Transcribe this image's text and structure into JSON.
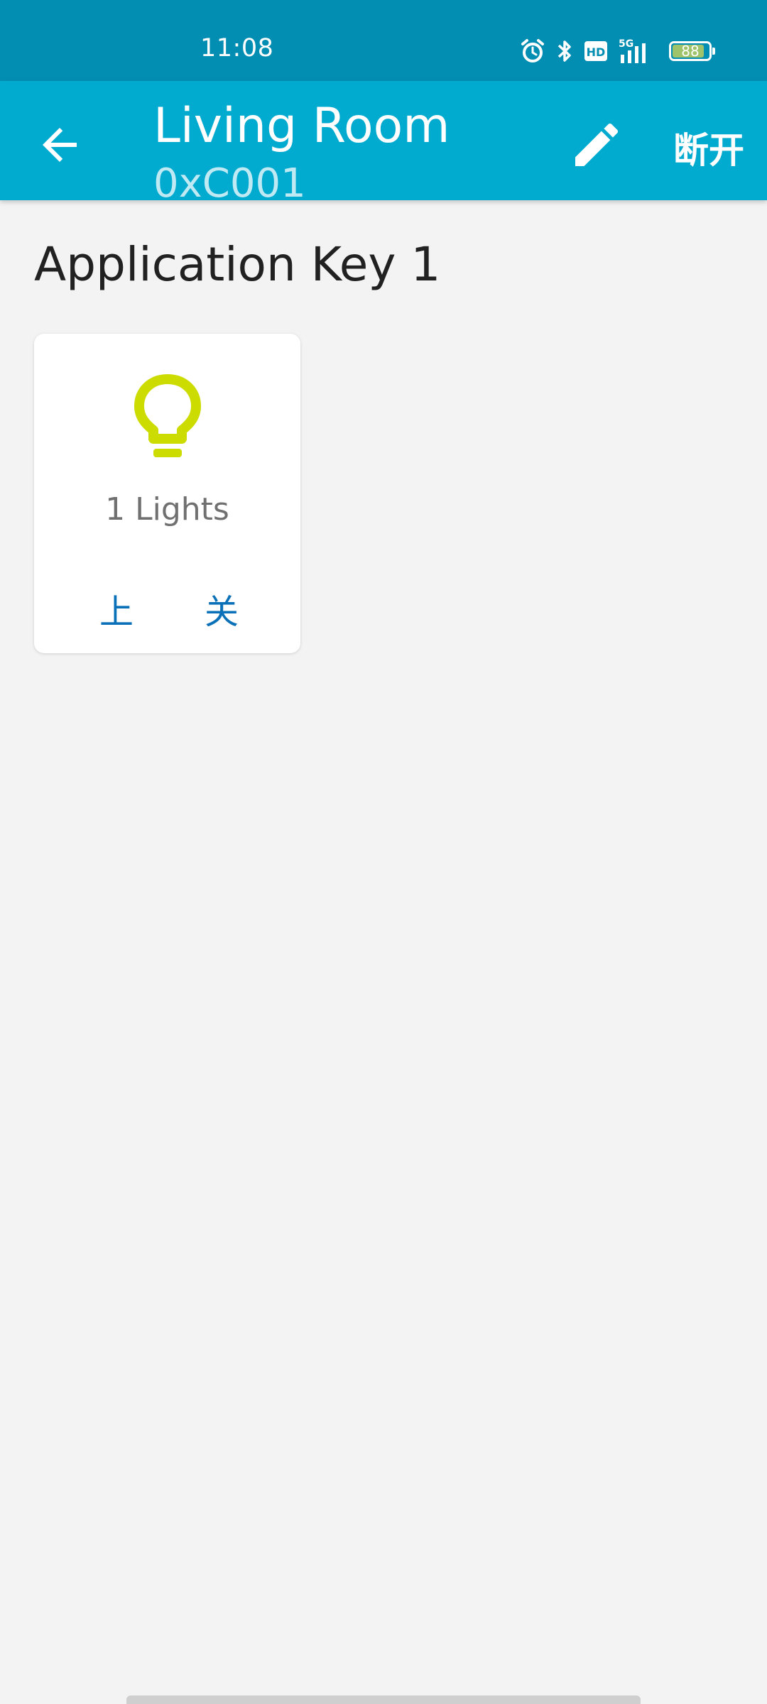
{
  "status_bar": {
    "time": "11:08",
    "network": "5G",
    "hd": "HD",
    "battery": "88",
    "battery_level": 0.88,
    "icons": [
      "alarm-icon",
      "bluetooth-icon",
      "hd-icon",
      "signal-icon",
      "battery-icon"
    ]
  },
  "app_bar": {
    "title": "Living Room",
    "subtitle": "0xC001",
    "disconnect_label": "断开",
    "background": "#01aacf"
  },
  "section": {
    "title": "Application Key 1"
  },
  "card": {
    "label": "1 Lights",
    "on_label": "上",
    "off_label": "关",
    "icon": "lightbulb-icon",
    "icon_color": "#cddc00",
    "action_color": "#0a70b8"
  }
}
